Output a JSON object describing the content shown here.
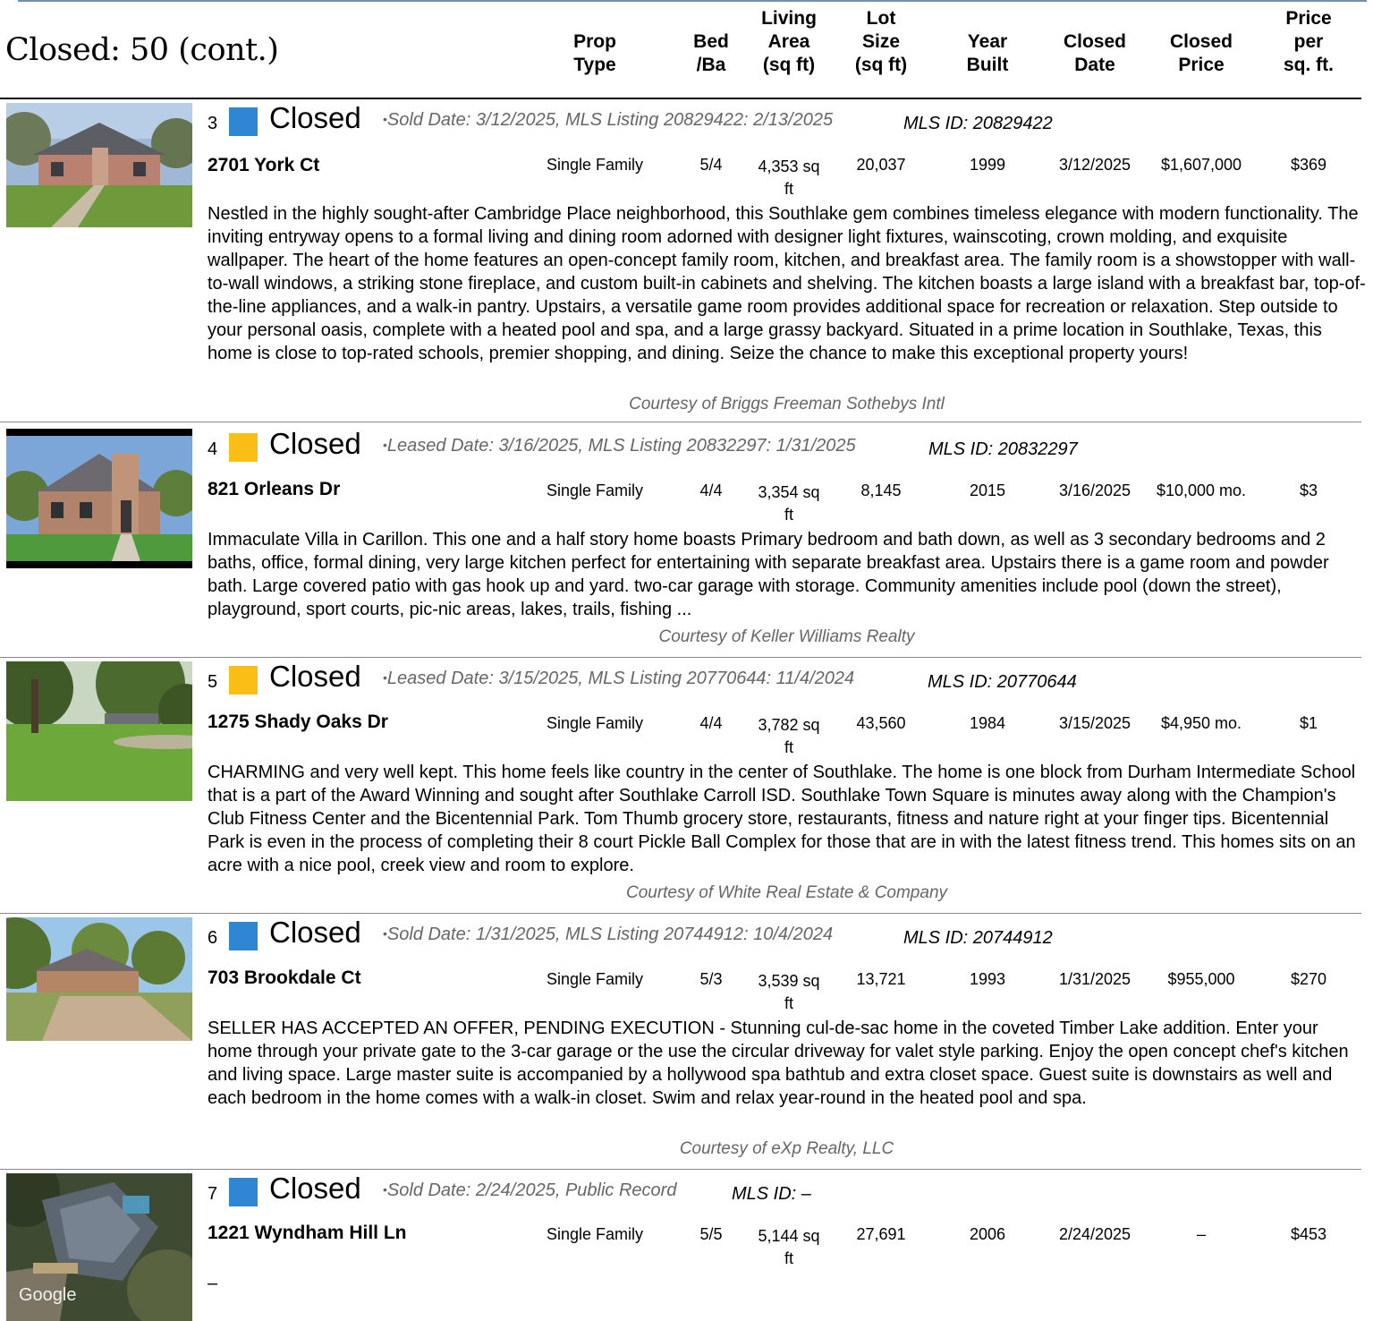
{
  "section_title": "Closed: 50 (cont.)",
  "columns": {
    "prop_type": "Prop\nType",
    "bed_ba": "Bed\n/Ba",
    "living_area": "Living\nArea\n(sq ft)",
    "lot_size": "Lot\nSize\n(sq ft)",
    "year_built": "Year\nBuilt",
    "closed_date": "Closed\nDate",
    "closed_price": "Closed\nPrice",
    "price_per_sqft": "Price\nper\nsq. ft."
  },
  "colors": {
    "sold": "#2f86d3",
    "leased": "#fbbe17"
  },
  "listings": [
    {
      "num": "3",
      "status": "Closed",
      "swatch": "sold",
      "dates": "Sold Date: 3/12/2025, MLS Listing 20829422: 2/13/2025",
      "mls_id": "MLS ID: 20829422",
      "address": "2701 York Ct",
      "prop_type": "Single Family",
      "bed_ba": "5/4",
      "living_area": "4,353 sq ft",
      "lot_size": "20,037",
      "year_built": "1999",
      "closed_date": "3/12/2025",
      "closed_price": "$1,607,000",
      "price_per_sqft": "$369",
      "description": "Nestled in the highly sought-after Cambridge Place neighborhood, this Southlake gem combines timeless elegance with modern functionality. The inviting entryway opens to a formal living and dining room adorned with designer light fixtures, wainscoting, crown molding, and exquisite wallpaper. The heart of the home features an open-concept family room, kitchen, and breakfast area. The family room is a showstopper with wall-to-wall windows, a striking stone fireplace, and custom built-in cabinets and shelving. The kitchen boasts a large island with a breakfast bar, top-of-the-line appliances, and a walk-in pantry. Upstairs, a versatile game room provides additional space for recreation or relaxation. Step outside to your personal oasis, complete with a heated pool and spa, and a large grassy backyard. Situated in a prime location in Southlake, Texas, this home is close to top-rated schools, premier shopping, and dining. Seize the chance to make this exceptional property yours!",
      "courtesy": "Courtesy of Briggs Freeman Sothebys Intl"
    },
    {
      "num": "4",
      "status": "Closed",
      "swatch": "leased",
      "dates": "Leased Date: 3/16/2025, MLS Listing 20832297: 1/31/2025",
      "mls_id": "MLS ID: 20832297",
      "address": "821 Orleans Dr",
      "prop_type": "Single Family",
      "bed_ba": "4/4",
      "living_area": "3,354 sq ft",
      "lot_size": "8,145",
      "year_built": "2015",
      "closed_date": "3/16/2025",
      "closed_price": "$10,000 mo.",
      "price_per_sqft": "$3",
      "description": "Immaculate Villa in Carillon. This one and a half story home boasts Primary bedroom and bath down, as well as 3 secondary bedrooms and 2 baths, office, formal dining, very large kitchen perfect for entertaining with separate breakfast area. Upstairs there is a game room and powder bath. Large covered patio with gas hook up and yard. two-car garage with storage. Community amenities include pool (down the street), playground, sport courts, pic-nic areas, lakes, trails, fishing ...",
      "courtesy": "Courtesy of Keller Williams Realty"
    },
    {
      "num": "5",
      "status": "Closed",
      "swatch": "leased",
      "dates": "Leased Date: 3/15/2025, MLS Listing 20770644: 11/4/2024",
      "mls_id": "MLS ID: 20770644",
      "address": "1275 Shady Oaks Dr",
      "prop_type": "Single Family",
      "bed_ba": "4/4",
      "living_area": "3,782 sq ft",
      "lot_size": "43,560",
      "year_built": "1984",
      "closed_date": "3/15/2025",
      "closed_price": "$4,950 mo.",
      "price_per_sqft": "$1",
      "description": "CHARMING and very well kept. This home feels like country in the center of Southlake. The home is one block from Durham Intermediate School that is a part of the Award Winning and sought after Southlake Carroll ISD. Southlake Town Square is minutes away along with the Champion's Club Fitness Center and the Bicentennial Park. Tom Thumb grocery store, restaurants, fitness and nature right at your finger tips. Bicentennial Park is even in the process of completing their 8 court Pickle Ball Complex for those that are in with the latest fitness trend. This homes sits on an acre with a nice pool, creek view and room to explore.",
      "courtesy": "Courtesy of White Real Estate & Company"
    },
    {
      "num": "6",
      "status": "Closed",
      "swatch": "sold",
      "dates": "Sold Date: 1/31/2025, MLS Listing 20744912: 10/4/2024",
      "mls_id": "MLS ID: 20744912",
      "address": "703 Brookdale Ct",
      "prop_type": "Single Family",
      "bed_ba": "5/3",
      "living_area": "3,539 sq ft",
      "lot_size": "13,721",
      "year_built": "1993",
      "closed_date": "1/31/2025",
      "closed_price": "$955,000",
      "price_per_sqft": "$270",
      "description": "SELLER HAS ACCEPTED AN OFFER, PENDING EXECUTION - Stunning cul-de-sac home in the coveted Timber Lake addition. Enter your home through your private gate to the 3-car garage or the use the circular driveway for valet style parking. Enjoy the open concept chef's kitchen and living space. Large master suite is accompanied by a hollywood spa bathtub and extra closet space. Guest suite is downstairs as well and each bedroom in the home comes with a walk-in closet. Swim and relax year-round in the heated pool and spa.",
      "courtesy": "Courtesy of eXp Realty, LLC"
    },
    {
      "num": "7",
      "status": "Closed",
      "swatch": "sold",
      "dates": "Sold Date: 2/24/2025, Public Record",
      "mls_id": "MLS ID: –",
      "address": "1221 Wyndham Hill Ln",
      "prop_type": "Single Family",
      "bed_ba": "5/5",
      "living_area": "5,144 sq ft",
      "lot_size": "27,691",
      "year_built": "2006",
      "closed_date": "2/24/2025",
      "closed_price": "–",
      "price_per_sqft": "$453",
      "description": "–",
      "courtesy": "",
      "photo_watermark": "Google"
    }
  ]
}
